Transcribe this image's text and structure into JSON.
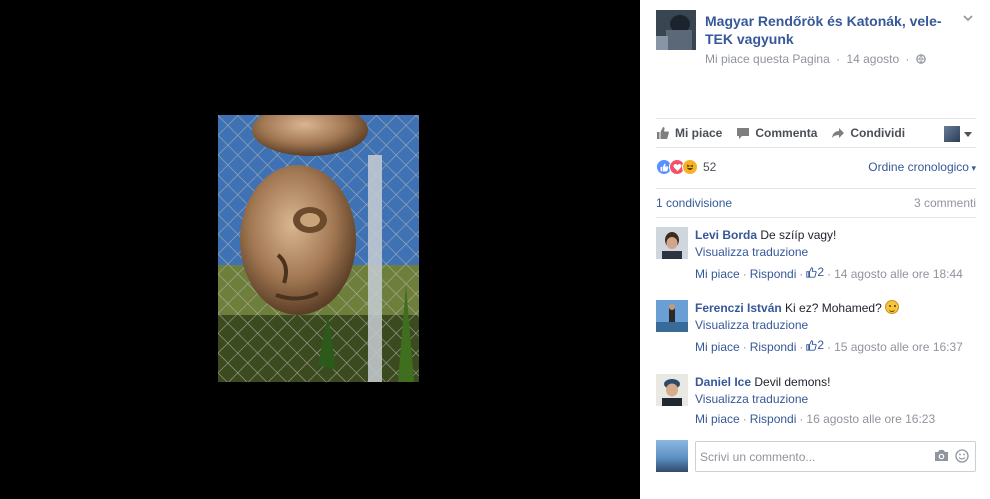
{
  "post": {
    "page_name": "Magyar Rendőrök és Katonák, vele-TEK vagyunk",
    "like_page_link": "Mi piace questa Pagina",
    "date": "14 agosto"
  },
  "actions": {
    "like": "Mi piace",
    "comment": "Commenta",
    "share": "Condividi"
  },
  "reactions": {
    "count": "52",
    "order_label": "Ordine cronologico"
  },
  "stats": {
    "shares": "1 condivisione",
    "comments": "3 commenti"
  },
  "comments": [
    {
      "author": "Levi Borda",
      "text": "De szííp vagy!",
      "translate": "Visualizza traduzione",
      "like": "Mi piace",
      "reply": "Rispondi",
      "likes": "2",
      "timestamp": "14 agosto alle ore 18:44"
    },
    {
      "author": "Ferenczi István",
      "text": "Ki ez? Mohamed?",
      "translate": "Visualizza traduzione",
      "like": "Mi piace",
      "reply": "Rispondi",
      "likes": "2",
      "timestamp": "15 agosto alle ore 16:37"
    },
    {
      "author": "Daniel Ice",
      "text": "Devil demons!",
      "translate": "Visualizza traduzione",
      "like": "Mi piace",
      "reply": "Rispondi",
      "timestamp": "16 agosto alle ore 16:23"
    }
  ],
  "composer": {
    "placeholder": "Scrivi un commento..."
  },
  "colors": {
    "link": "#365899",
    "muted": "#90949c",
    "viewer_bg": "#000000"
  }
}
